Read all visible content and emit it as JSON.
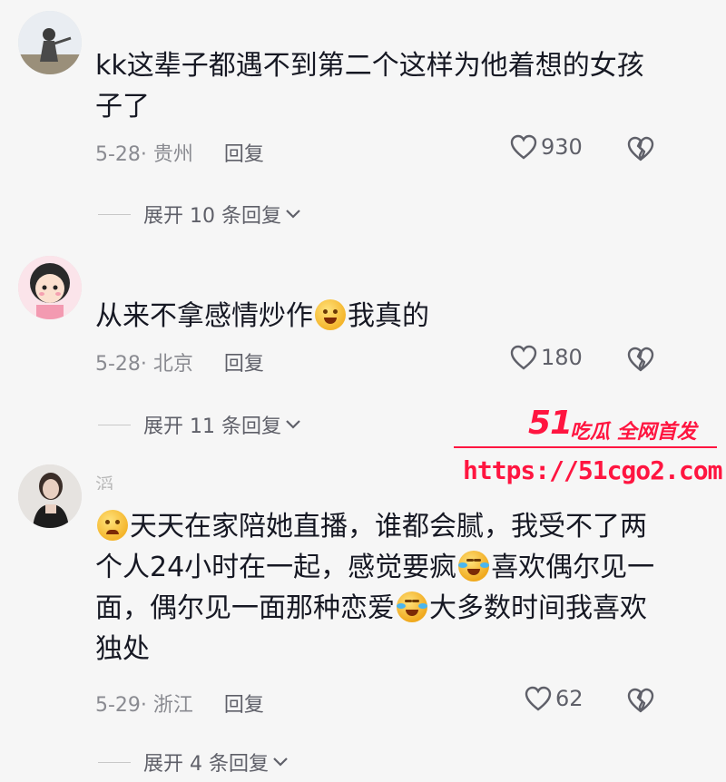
{
  "comments": [
    {
      "username": "",
      "text_parts": [
        "kk这辈子都遇不到第二个这样为他着想的女孩子了"
      ],
      "meta": "5-28· 贵州",
      "reply_label": "回复",
      "likes": "930",
      "expand_label": "展开 10 条回复"
    },
    {
      "username": "",
      "text_parts": [
        "从来不拿感情炒作",
        "我真的"
      ],
      "meta": "5-28· 北京",
      "reply_label": "回复",
      "likes": "180",
      "expand_label": "展开 11 条回复"
    },
    {
      "username": "滔",
      "text_parts": [
        "天天在家陪她直播，谁都会腻，我受不了两个人24小时在一起，感觉要疯",
        "喜欢偶尔见一面，偶尔见一面那种恋爱",
        "大多数时间我喜欢独处"
      ],
      "meta": "5-29· 浙江",
      "reply_label": "回复",
      "likes": "62",
      "expand_label": "展开 4 条回复"
    }
  ],
  "watermark": {
    "brand": "51",
    "brand_cn": "吃瓜 全网首发",
    "url": "https://51cgo2.com"
  },
  "colors": {
    "background": "#f6f6f6",
    "text": "#161823",
    "meta": "#8a8b91",
    "watermark": "#ff1540"
  }
}
